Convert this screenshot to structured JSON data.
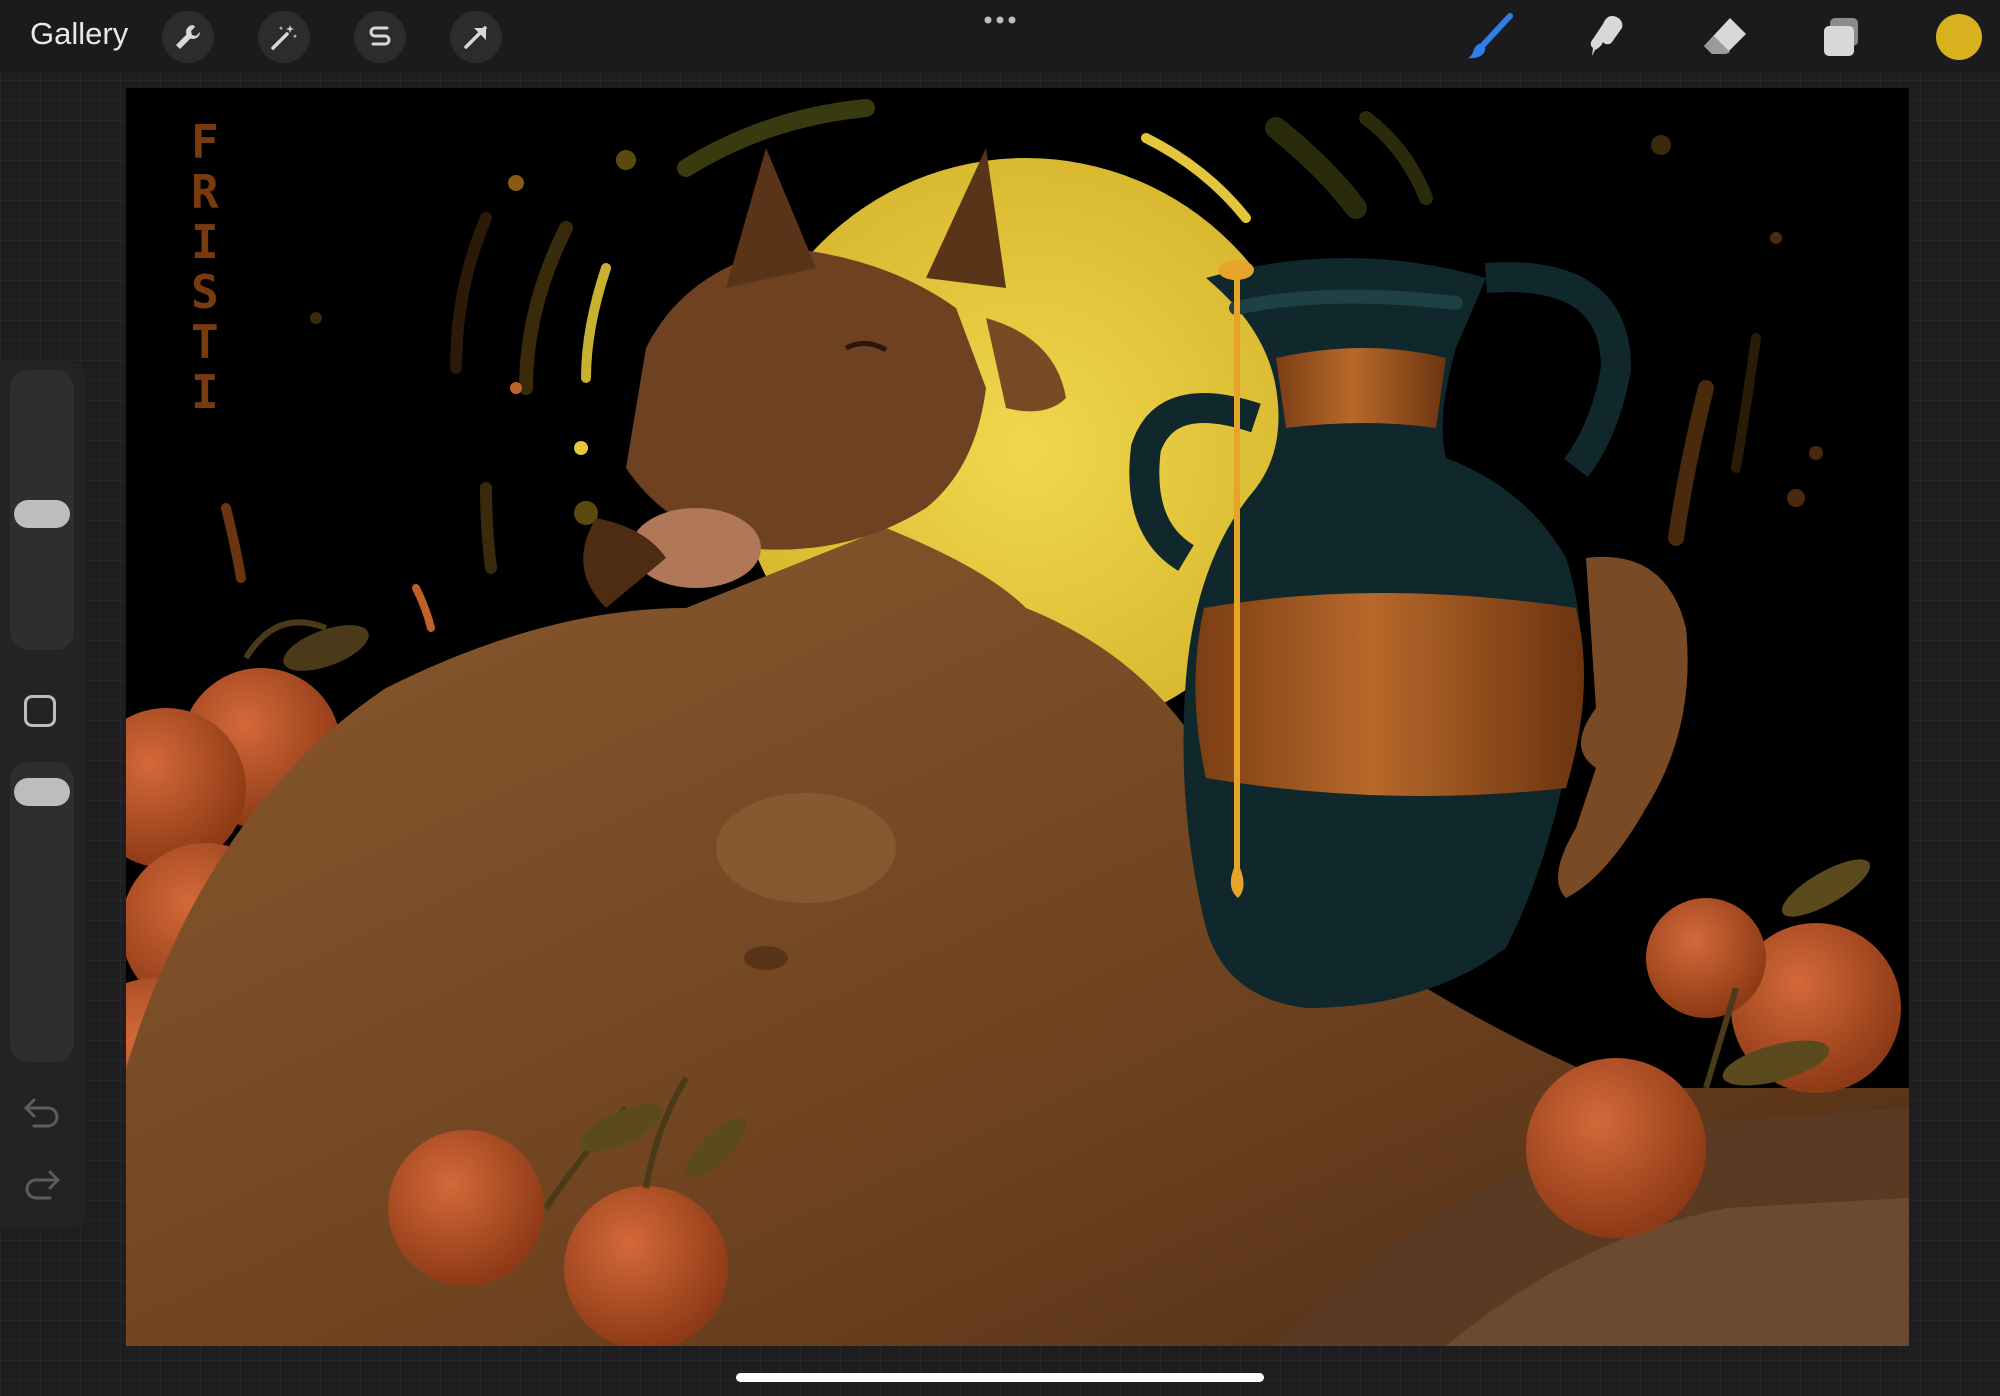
{
  "toolbar": {
    "gallery_label": "Gallery",
    "left_tools": [
      "wrench-icon",
      "magic-wand-icon",
      "selection-icon",
      "transform-arrow-icon"
    ],
    "right_tools": [
      "brush-icon",
      "smudge-icon",
      "eraser-icon",
      "layers-icon"
    ],
    "active_tool": "brush-icon",
    "current_color": "#d8b21e"
  },
  "canvas": {
    "signature": "FRISTI",
    "palette": {
      "background": "#000000",
      "moon": "#e3c63c",
      "skin": "#7a4a24",
      "jug_body": "#10282c",
      "jug_band": "#9a5520",
      "fruit": "#c05a2a",
      "honey": "#e6a52a"
    }
  },
  "sidebar": {
    "controls": [
      "brush-size-slider",
      "modify-button",
      "opacity-slider",
      "undo-icon",
      "redo-icon"
    ]
  }
}
